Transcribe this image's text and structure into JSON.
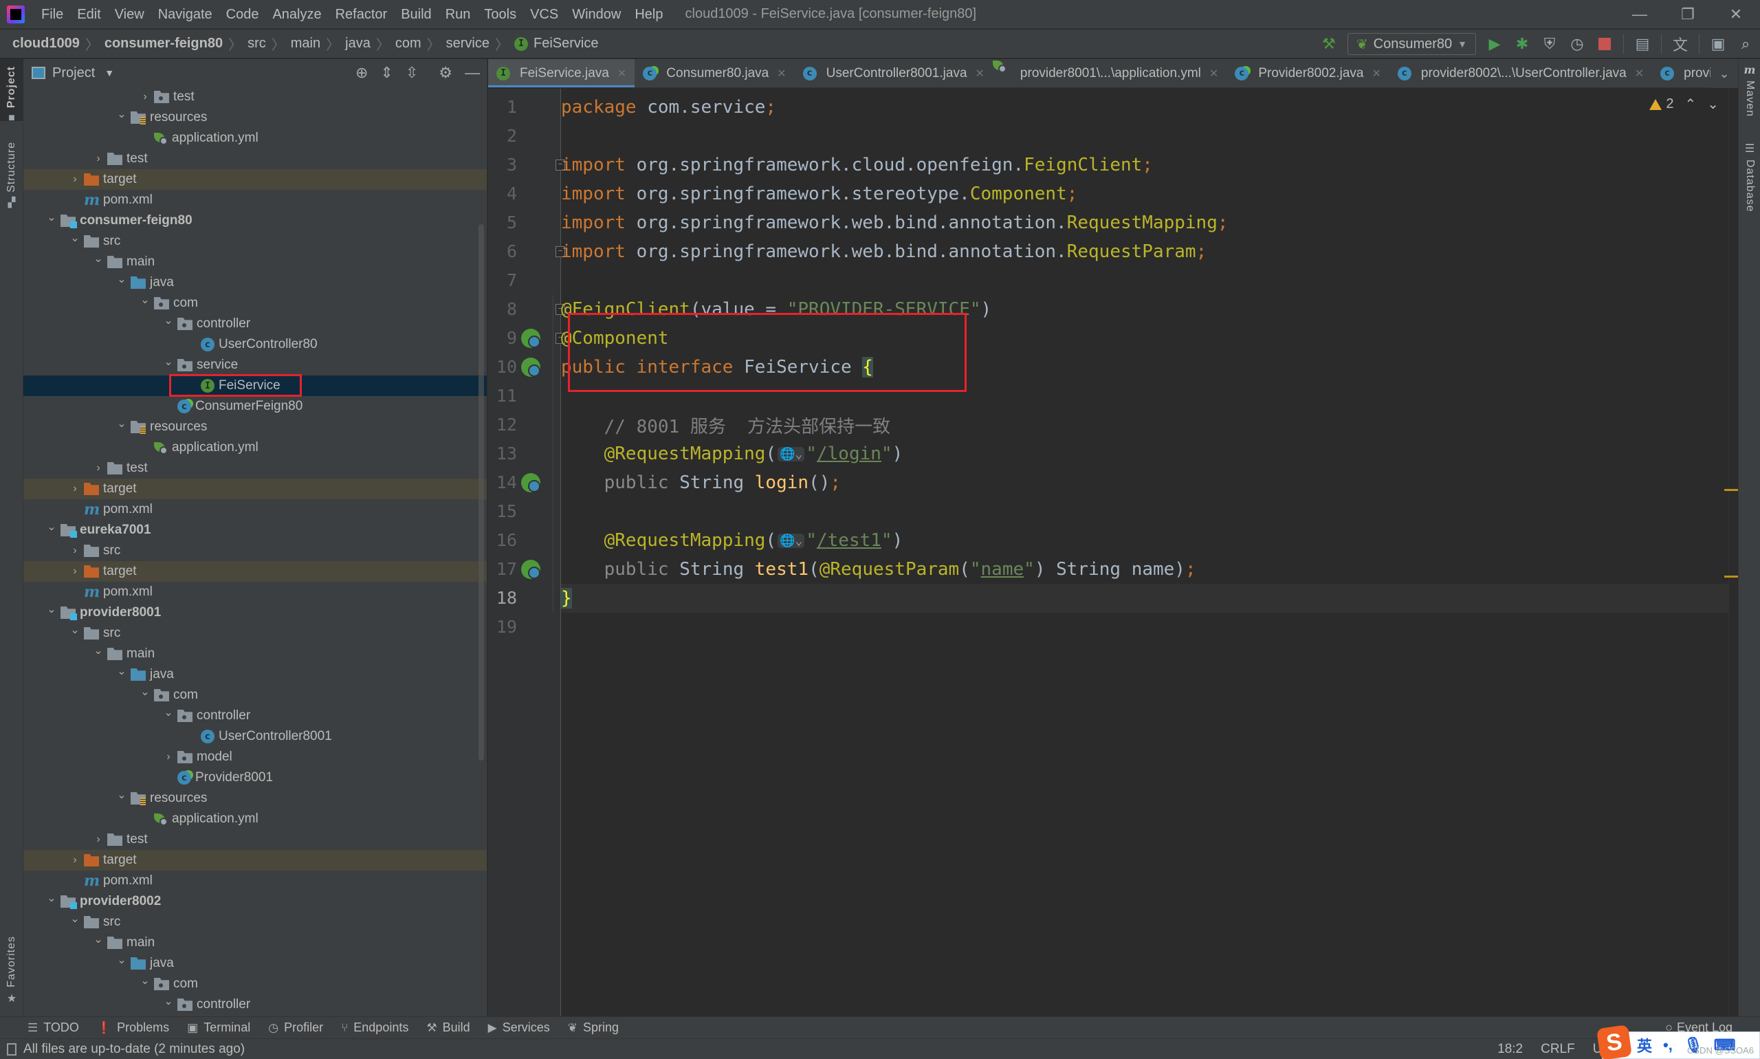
{
  "window": {
    "title": "cloud1009 - FeiService.java [consumer-feign80]",
    "menu": [
      "File",
      "Edit",
      "View",
      "Navigate",
      "Code",
      "Analyze",
      "Refactor",
      "Build",
      "Run",
      "Tools",
      "VCS",
      "Window",
      "Help"
    ],
    "controls": {
      "minimize": "—",
      "restore": "❐",
      "close": "✕"
    }
  },
  "breadcrumb": {
    "items": [
      "cloud1009",
      "consumer-feign80",
      "src",
      "main",
      "java",
      "com",
      "service"
    ],
    "file": "FeiService",
    "file_icon": "I"
  },
  "toolbar": {
    "run_config": "Consumer80",
    "icons": [
      "build-hammer",
      "run",
      "debug",
      "coverage",
      "profile",
      "stop",
      "project-structure",
      "translate",
      "terminal",
      "search"
    ]
  },
  "left_strip": {
    "project": "Project",
    "structure": "Structure",
    "favorites": "Favorites"
  },
  "right_strip": {
    "maven": "Maven",
    "database": "Database"
  },
  "project_panel": {
    "title": "Project",
    "tree": [
      {
        "label": "test",
        "type": "folder-pkg",
        "depth": 4,
        "arrow": "›"
      },
      {
        "label": "resources",
        "type": "folder-res",
        "depth": 3,
        "arrow": "⌄"
      },
      {
        "label": "application.yml",
        "type": "yml",
        "depth": 4,
        "arrow": ""
      },
      {
        "label": "test",
        "type": "folder",
        "depth": 2,
        "arrow": "›"
      },
      {
        "label": "target",
        "type": "folder-target",
        "depth": 1,
        "arrow": "›",
        "excluded": true
      },
      {
        "label": "pom.xml",
        "type": "maven",
        "depth": 1,
        "arrow": ""
      },
      {
        "label": "consumer-feign80",
        "type": "module",
        "depth": 0,
        "arrow": "⌄"
      },
      {
        "label": "src",
        "type": "folder",
        "depth": 1,
        "arrow": "⌄"
      },
      {
        "label": "main",
        "type": "folder",
        "depth": 2,
        "arrow": "⌄"
      },
      {
        "label": "java",
        "type": "folder-src",
        "depth": 3,
        "arrow": "⌄"
      },
      {
        "label": "com",
        "type": "folder-pkg",
        "depth": 4,
        "arrow": "⌄"
      },
      {
        "label": "controller",
        "type": "folder-pkg",
        "depth": 5,
        "arrow": "⌄"
      },
      {
        "label": "UserController80",
        "type": "class",
        "depth": 6,
        "arrow": ""
      },
      {
        "label": "service",
        "type": "folder-pkg",
        "depth": 5,
        "arrow": "⌄"
      },
      {
        "label": "FeiService",
        "type": "interface",
        "depth": 6,
        "arrow": "",
        "selected": true
      },
      {
        "label": "ConsumerFeign80",
        "type": "boot",
        "depth": 5,
        "arrow": ""
      },
      {
        "label": "resources",
        "type": "folder-res",
        "depth": 3,
        "arrow": "⌄"
      },
      {
        "label": "application.yml",
        "type": "yml",
        "depth": 4,
        "arrow": ""
      },
      {
        "label": "test",
        "type": "folder",
        "depth": 2,
        "arrow": "›"
      },
      {
        "label": "target",
        "type": "folder-target",
        "depth": 1,
        "arrow": "›",
        "excluded": true
      },
      {
        "label": "pom.xml",
        "type": "maven",
        "depth": 1,
        "arrow": ""
      },
      {
        "label": "eureka7001",
        "type": "module",
        "depth": 0,
        "arrow": "⌄"
      },
      {
        "label": "src",
        "type": "folder",
        "depth": 1,
        "arrow": "›"
      },
      {
        "label": "target",
        "type": "folder-target",
        "depth": 1,
        "arrow": "›",
        "excluded": true
      },
      {
        "label": "pom.xml",
        "type": "maven",
        "depth": 1,
        "arrow": ""
      },
      {
        "label": "provider8001",
        "type": "module",
        "depth": 0,
        "arrow": "⌄"
      },
      {
        "label": "src",
        "type": "folder",
        "depth": 1,
        "arrow": "⌄"
      },
      {
        "label": "main",
        "type": "folder",
        "depth": 2,
        "arrow": "⌄"
      },
      {
        "label": "java",
        "type": "folder-src",
        "depth": 3,
        "arrow": "⌄"
      },
      {
        "label": "com",
        "type": "folder-pkg",
        "depth": 4,
        "arrow": "⌄"
      },
      {
        "label": "controller",
        "type": "folder-pkg",
        "depth": 5,
        "arrow": "⌄"
      },
      {
        "label": "UserController8001",
        "type": "class",
        "depth": 6,
        "arrow": ""
      },
      {
        "label": "model",
        "type": "folder-pkg",
        "depth": 5,
        "arrow": "›"
      },
      {
        "label": "Provider8001",
        "type": "boot",
        "depth": 5,
        "arrow": ""
      },
      {
        "label": "resources",
        "type": "folder-res",
        "depth": 3,
        "arrow": "⌄"
      },
      {
        "label": "application.yml",
        "type": "yml",
        "depth": 4,
        "arrow": ""
      },
      {
        "label": "test",
        "type": "folder",
        "depth": 2,
        "arrow": "›"
      },
      {
        "label": "target",
        "type": "folder-target",
        "depth": 1,
        "arrow": "›",
        "excluded": true
      },
      {
        "label": "pom.xml",
        "type": "maven",
        "depth": 1,
        "arrow": ""
      },
      {
        "label": "provider8002",
        "type": "module",
        "depth": 0,
        "arrow": "⌄"
      },
      {
        "label": "src",
        "type": "folder",
        "depth": 1,
        "arrow": "⌄"
      },
      {
        "label": "main",
        "type": "folder",
        "depth": 2,
        "arrow": "⌄"
      },
      {
        "label": "java",
        "type": "folder-src",
        "depth": 3,
        "arrow": "⌄"
      },
      {
        "label": "com",
        "type": "folder-pkg",
        "depth": 4,
        "arrow": "⌄"
      },
      {
        "label": "controller",
        "type": "folder-pkg",
        "depth": 5,
        "arrow": "⌄"
      }
    ]
  },
  "editor_tabs": [
    {
      "label": "FeiService.java",
      "icon": "interface",
      "active": true
    },
    {
      "label": "Consumer80.java",
      "icon": "boot"
    },
    {
      "label": "UserController8001.java",
      "icon": "class"
    },
    {
      "label": "provider8001\\...\\application.yml",
      "icon": "yml"
    },
    {
      "label": "Provider8002.java",
      "icon": "boot"
    },
    {
      "label": "provider8002\\...\\UserController.java",
      "icon": "class"
    },
    {
      "label": "provide",
      "icon": "class",
      "truncated": true
    }
  ],
  "editor": {
    "warnings_count": "2",
    "current_line": 18,
    "lines": [
      {
        "n": 1,
        "tokens": [
          [
            "kw",
            "package "
          ],
          [
            "pl",
            "com.service"
          ],
          [
            "kw",
            ";"
          ]
        ]
      },
      {
        "n": 2,
        "tokens": []
      },
      {
        "n": 3,
        "tokens": [
          [
            "kw",
            "import "
          ],
          [
            "pl",
            "org.springframework.cloud.openfeign."
          ],
          [
            "ann",
            "FeignClient"
          ],
          [
            "kw",
            ";"
          ]
        ],
        "fold": "-"
      },
      {
        "n": 4,
        "tokens": [
          [
            "kw",
            "import "
          ],
          [
            "pl",
            "org.springframework.stereotype."
          ],
          [
            "ann",
            "Component"
          ],
          [
            "kw",
            ";"
          ]
        ]
      },
      {
        "n": 5,
        "tokens": [
          [
            "kw",
            "import "
          ],
          [
            "pl",
            "org.springframework.web.bind.annotation."
          ],
          [
            "ann",
            "RequestMapping"
          ],
          [
            "kw",
            ";"
          ]
        ]
      },
      {
        "n": 6,
        "tokens": [
          [
            "kw",
            "import "
          ],
          [
            "pl",
            "org.springframework.web.bind.annotation."
          ],
          [
            "ann",
            "RequestParam"
          ],
          [
            "kw",
            ";"
          ]
        ],
        "fold": "-"
      },
      {
        "n": 7,
        "tokens": []
      },
      {
        "n": 8,
        "tokens": [
          [
            "ann",
            "@FeignClient"
          ],
          [
            "pl",
            "(value = "
          ],
          [
            "str",
            "\"PROVIDER-SERVICE\""
          ],
          [
            "pl",
            ")"
          ]
        ],
        "fold": "-"
      },
      {
        "n": 9,
        "tokens": [
          [
            "ann",
            "@Component"
          ]
        ],
        "fold": "-",
        "gutter": "bean"
      },
      {
        "n": 10,
        "tokens": [
          [
            "kw",
            "public interface "
          ],
          [
            "pl",
            "FeiService "
          ],
          [
            "brace",
            "{"
          ]
        ],
        "gutter": "impl"
      },
      {
        "n": 11,
        "tokens": []
      },
      {
        "n": 12,
        "tokens": [
          [
            "pl",
            "    "
          ],
          [
            "cmt",
            "// 8001 服务  方法头部保持一致"
          ]
        ]
      },
      {
        "n": 13,
        "tokens": [
          [
            "pl",
            "    "
          ],
          [
            "ann",
            "@RequestMapping"
          ],
          [
            "pl",
            "("
          ],
          [
            "globe",
            "🌐⌄"
          ],
          [
            "str",
            "\""
          ],
          [
            "url",
            "/login"
          ],
          [
            "str",
            "\""
          ],
          [
            "pl",
            ")"
          ]
        ]
      },
      {
        "n": 14,
        "tokens": [
          [
            "pl",
            "    "
          ],
          [
            "muted",
            "public "
          ],
          [
            "pl",
            "String "
          ],
          [
            "fn",
            "login"
          ],
          [
            "pl",
            "()"
          ],
          [
            "kw",
            ";"
          ]
        ],
        "gutter": "endpoint"
      },
      {
        "n": 15,
        "tokens": []
      },
      {
        "n": 16,
        "tokens": [
          [
            "pl",
            "    "
          ],
          [
            "ann",
            "@RequestMapping"
          ],
          [
            "pl",
            "("
          ],
          [
            "globe",
            "🌐⌄"
          ],
          [
            "str",
            "\""
          ],
          [
            "url",
            "/test1"
          ],
          [
            "str",
            "\""
          ],
          [
            "pl",
            ")"
          ]
        ]
      },
      {
        "n": 17,
        "tokens": [
          [
            "pl",
            "    "
          ],
          [
            "muted",
            "public "
          ],
          [
            "pl",
            "String "
          ],
          [
            "fn",
            "test1"
          ],
          [
            "pl",
            "("
          ],
          [
            "ann",
            "@RequestParam"
          ],
          [
            "pl",
            "("
          ],
          [
            "str",
            "\""
          ],
          [
            "url",
            "name"
          ],
          [
            "str",
            "\""
          ],
          [
            "pl",
            ") String name)"
          ],
          [
            "kw",
            ";"
          ]
        ],
        "gutter": "endpoint"
      },
      {
        "n": 18,
        "tokens": [
          [
            "brace",
            "}"
          ]
        ]
      },
      {
        "n": 19,
        "tokens": []
      }
    ]
  },
  "bottom_tools": [
    {
      "label": "TODO",
      "icon": "☰"
    },
    {
      "label": "Problems",
      "icon": "❗"
    },
    {
      "label": "Terminal",
      "icon": "▣"
    },
    {
      "label": "Profiler",
      "icon": "◷"
    },
    {
      "label": "Endpoints",
      "icon": "⑂"
    },
    {
      "label": "Build",
      "icon": "⚒"
    },
    {
      "label": "Services",
      "icon": "▶"
    },
    {
      "label": "Spring",
      "icon": "❦"
    }
  ],
  "event_log": "Event Log",
  "status": {
    "message": "All files are up-to-date (2 minutes ago)",
    "position": "18:2",
    "line_sep": "CRLF",
    "encoding": "UTF-"
  },
  "ime": {
    "logo": "S",
    "lang": "英",
    "punct": "•,",
    "watermark": "CSDN @SSOA6"
  },
  "colors": {
    "accent": "#4a88c7",
    "highlight_box": "#e5232b",
    "selection": "#0d293e"
  }
}
